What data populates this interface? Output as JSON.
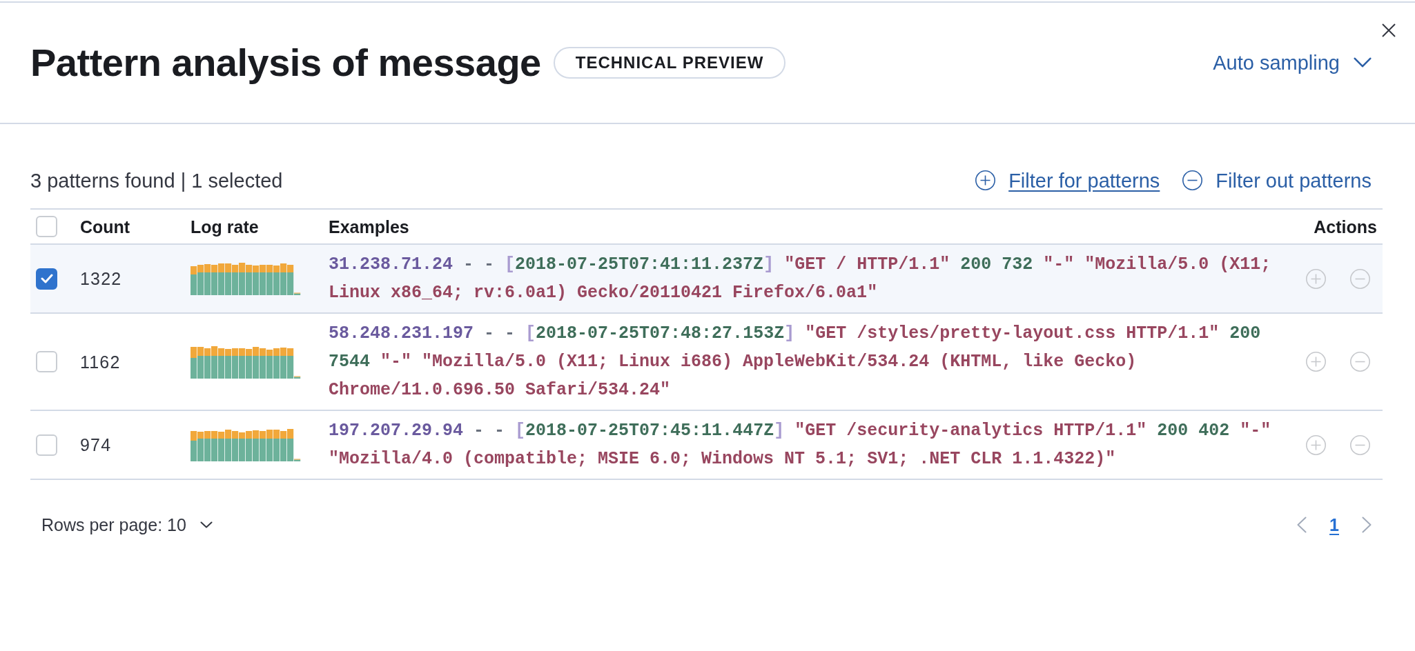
{
  "flyout": {
    "title": "Pattern analysis of message",
    "badge": "TECHNICAL PREVIEW",
    "sampling": {
      "label": "Auto sampling"
    }
  },
  "toolbar": {
    "summary": "3 patterns found | 1 selected",
    "actions": [
      {
        "kind": "include",
        "label": "Filter for patterns",
        "hovered": true
      },
      {
        "kind": "exclude",
        "label": "Filter out patterns",
        "hovered": false
      }
    ]
  },
  "table": {
    "select_all": {
      "checked": false
    },
    "columns": [
      "Count",
      "Log rate",
      "Examples",
      "Actions"
    ],
    "rows": [
      {
        "selected": true,
        "count": "1322",
        "example": [
          {
            "kind": "ip",
            "text": "31.238.71.24"
          },
          {
            "kind": "plain",
            "text": " - - "
          },
          {
            "kind": "bracket",
            "text": "["
          },
          {
            "kind": "timestamp",
            "text": "2018-07-25T07:41:11.237Z"
          },
          {
            "kind": "bracket",
            "text": "]"
          },
          {
            "kind": "string",
            "text": " \"GET / HTTP/1.1\""
          },
          {
            "kind": "number",
            "text": " 200 732"
          },
          {
            "kind": "string",
            "text": " \"-\" \"Mozilla/5.0 (X11; Linux x86_64; rv:6.0a1) Gecko/20110421 Firefox/6.0a1\""
          }
        ],
        "actions": [
          {
            "kind": "include",
            "disabled": true
          },
          {
            "kind": "exclude",
            "disabled": true
          }
        ]
      },
      {
        "selected": false,
        "count": "1162",
        "example": [
          {
            "kind": "ip",
            "text": "58.248.231.197"
          },
          {
            "kind": "plain",
            "text": " - - "
          },
          {
            "kind": "bracket",
            "text": "["
          },
          {
            "kind": "timestamp",
            "text": "2018-07-25T07:48:27.153Z"
          },
          {
            "kind": "bracket",
            "text": "]"
          },
          {
            "kind": "string",
            "text": " \"GET /styles/pretty-layout.css HTTP/1.1\""
          },
          {
            "kind": "number",
            "text": " 200 7544"
          },
          {
            "kind": "string",
            "text": " \"-\" \"Mozilla/5.0 (X11; Linux i686) AppleWebKit/534.24 (KHTML, like Gecko) Chrome/11.0.696.50 Safari/534.24\""
          }
        ],
        "actions": [
          {
            "kind": "include",
            "disabled": true
          },
          {
            "kind": "exclude",
            "disabled": true
          }
        ]
      },
      {
        "selected": false,
        "count": "974",
        "example": [
          {
            "kind": "ip",
            "text": "197.207.29.94"
          },
          {
            "kind": "plain",
            "text": " - - "
          },
          {
            "kind": "bracket",
            "text": "["
          },
          {
            "kind": "timestamp",
            "text": "2018-07-25T07:45:11.447Z"
          },
          {
            "kind": "bracket",
            "text": "]"
          },
          {
            "kind": "string",
            "text": " \"GET /security-analytics HTTP/1.1\""
          },
          {
            "kind": "number",
            "text": " 200 402"
          },
          {
            "kind": "string",
            "text": " \"-\" \"Mozilla/4.0 (compatible; MSIE 6.0; Windows NT 5.1; SV1; .NET CLR 1.1.4322)\""
          }
        ],
        "actions": [
          {
            "kind": "include",
            "disabled": true
          },
          {
            "kind": "exclude",
            "disabled": true
          }
        ]
      }
    ]
  },
  "footer": {
    "rows_per_page": "Rows per page: 10",
    "previous": {
      "disabled": true
    },
    "pages": [
      {
        "label": "1",
        "selected": true
      }
    ],
    "next": {
      "disabled": true
    }
  }
}
